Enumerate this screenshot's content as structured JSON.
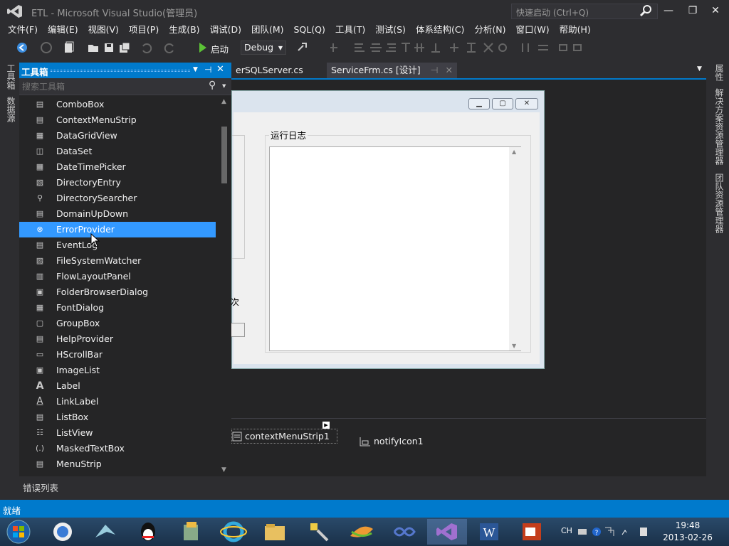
{
  "window": {
    "title": "ETL - Microsoft Visual Studio(管理员)",
    "quick_launch_placeholder": "快速启动 (Ctrl+Q)"
  },
  "menu": [
    "文件(F)",
    "编辑(E)",
    "视图(V)",
    "项目(P)",
    "生成(B)",
    "调试(D)",
    "团队(M)",
    "SQL(Q)",
    "工具(T)",
    "测试(S)",
    "体系结构(C)",
    "分析(N)",
    "窗口(W)",
    "帮助(H)"
  ],
  "toolbar": {
    "start_label": "启动",
    "config": "Debug"
  },
  "left_strip": {
    "toolbox": "工具箱",
    "datasource": "数据源"
  },
  "right_strip": {
    "properties": "属性",
    "solution": "解决方案资源管理器",
    "team": "团队资源管理器"
  },
  "doc_tabs": [
    {
      "label": "erSQLServer.cs"
    },
    {
      "label": "ServiceFrm.cs [设计]"
    }
  ],
  "form": {
    "log_label": "运行日志",
    "left_text": "次"
  },
  "tray": {
    "item1": "contextMenuStrip1",
    "item2": "notifyIcon1"
  },
  "toolbox": {
    "title": "工具箱",
    "search_placeholder": "搜索工具箱",
    "items": [
      {
        "label": "ComboBox",
        "icon": "▤"
      },
      {
        "label": "ContextMenuStrip",
        "icon": "▤"
      },
      {
        "label": "DataGridView",
        "icon": "▦"
      },
      {
        "label": "DataSet",
        "icon": "◫"
      },
      {
        "label": "DateTimePicker",
        "icon": "▦"
      },
      {
        "label": "DirectoryEntry",
        "icon": "▧"
      },
      {
        "label": "DirectorySearcher",
        "icon": "⚲"
      },
      {
        "label": "DomainUpDown",
        "icon": "▤"
      },
      {
        "label": "ErrorProvider",
        "icon": "⊗",
        "selected": true
      },
      {
        "label": "EventLog",
        "icon": "▤"
      },
      {
        "label": "FileSystemWatcher",
        "icon": "▨"
      },
      {
        "label": "FlowLayoutPanel",
        "icon": "▥"
      },
      {
        "label": "FolderBrowserDialog",
        "icon": "▣"
      },
      {
        "label": "FontDialog",
        "icon": "▦"
      },
      {
        "label": "GroupBox",
        "icon": "▢"
      },
      {
        "label": "HelpProvider",
        "icon": "▤"
      },
      {
        "label": "HScrollBar",
        "icon": "▭"
      },
      {
        "label": "ImageList",
        "icon": "▣"
      },
      {
        "label": "Label",
        "icon": "A"
      },
      {
        "label": "LinkLabel",
        "icon": "A"
      },
      {
        "label": "ListBox",
        "icon": "▤"
      },
      {
        "label": "ListView",
        "icon": "☷"
      },
      {
        "label": "MaskedTextBox",
        "icon": "(.)"
      },
      {
        "label": "MenuStrip",
        "icon": "▤"
      }
    ]
  },
  "error_list_tab": "错误列表",
  "status": "就绪",
  "taskbar": {
    "lang": "CH",
    "time": "19:48",
    "date": "2013-02-26"
  },
  "colors": {
    "accent": "#007acc",
    "selection": "#3399ff",
    "bg": "#2d2d30"
  }
}
